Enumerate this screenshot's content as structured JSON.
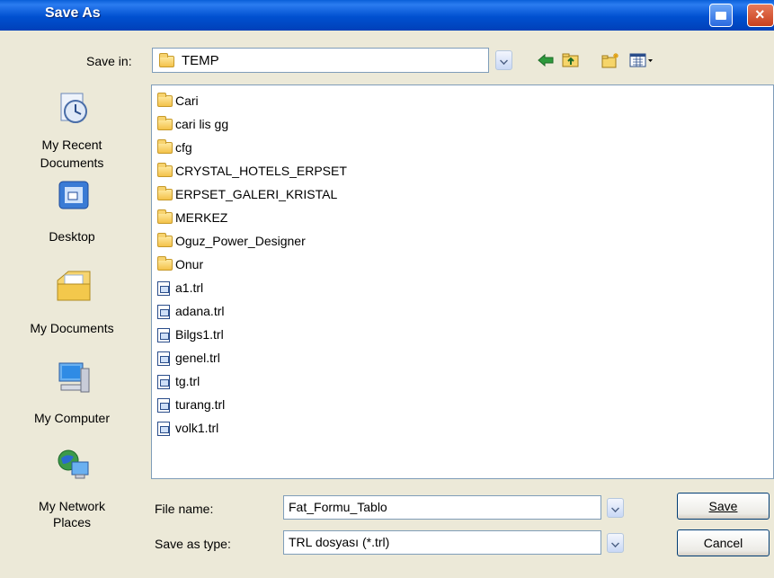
{
  "window": {
    "title": "Save As"
  },
  "save_in": {
    "label": "Save in:",
    "value": "TEMP"
  },
  "places": [
    {
      "label": "My Recent Documents",
      "icon": "recent-documents-icon"
    },
    {
      "label": "Desktop",
      "icon": "desktop-icon"
    },
    {
      "label": "My Documents",
      "icon": "my-documents-icon"
    },
    {
      "label": "My Computer",
      "icon": "my-computer-icon"
    },
    {
      "label": "My Network Places",
      "icon": "network-places-icon"
    }
  ],
  "place_lines": {
    "recent1": "My Recent",
    "recent2": "Documents",
    "net1": "My Network",
    "net2": "Places"
  },
  "files": [
    {
      "name": "Cari",
      "type": "folder"
    },
    {
      "name": "cari lis gg",
      "type": "folder"
    },
    {
      "name": "cfg",
      "type": "folder"
    },
    {
      "name": "CRYSTAL_HOTELS_ERPSET",
      "type": "folder"
    },
    {
      "name": "ERPSET_GALERI_KRISTAL",
      "type": "folder"
    },
    {
      "name": "MERKEZ",
      "type": "folder"
    },
    {
      "name": "Oguz_Power_Designer",
      "type": "folder"
    },
    {
      "name": "Onur",
      "type": "folder"
    },
    {
      "name": "a1.trl",
      "type": "file"
    },
    {
      "name": "adana.trl",
      "type": "file"
    },
    {
      "name": "Bilgs1.trl",
      "type": "file"
    },
    {
      "name": "genel.trl",
      "type": "file"
    },
    {
      "name": "tg.trl",
      "type": "file"
    },
    {
      "name": "turang.trl",
      "type": "file"
    },
    {
      "name": "volk1.trl",
      "type": "file"
    }
  ],
  "filename": {
    "label": "File name:",
    "value": "Fat_Formu_Tablo"
  },
  "filetype": {
    "label": "Save as type:",
    "value": "TRL dosyası (*.trl)"
  },
  "buttons": {
    "save": "Save",
    "cancel": "Cancel"
  }
}
